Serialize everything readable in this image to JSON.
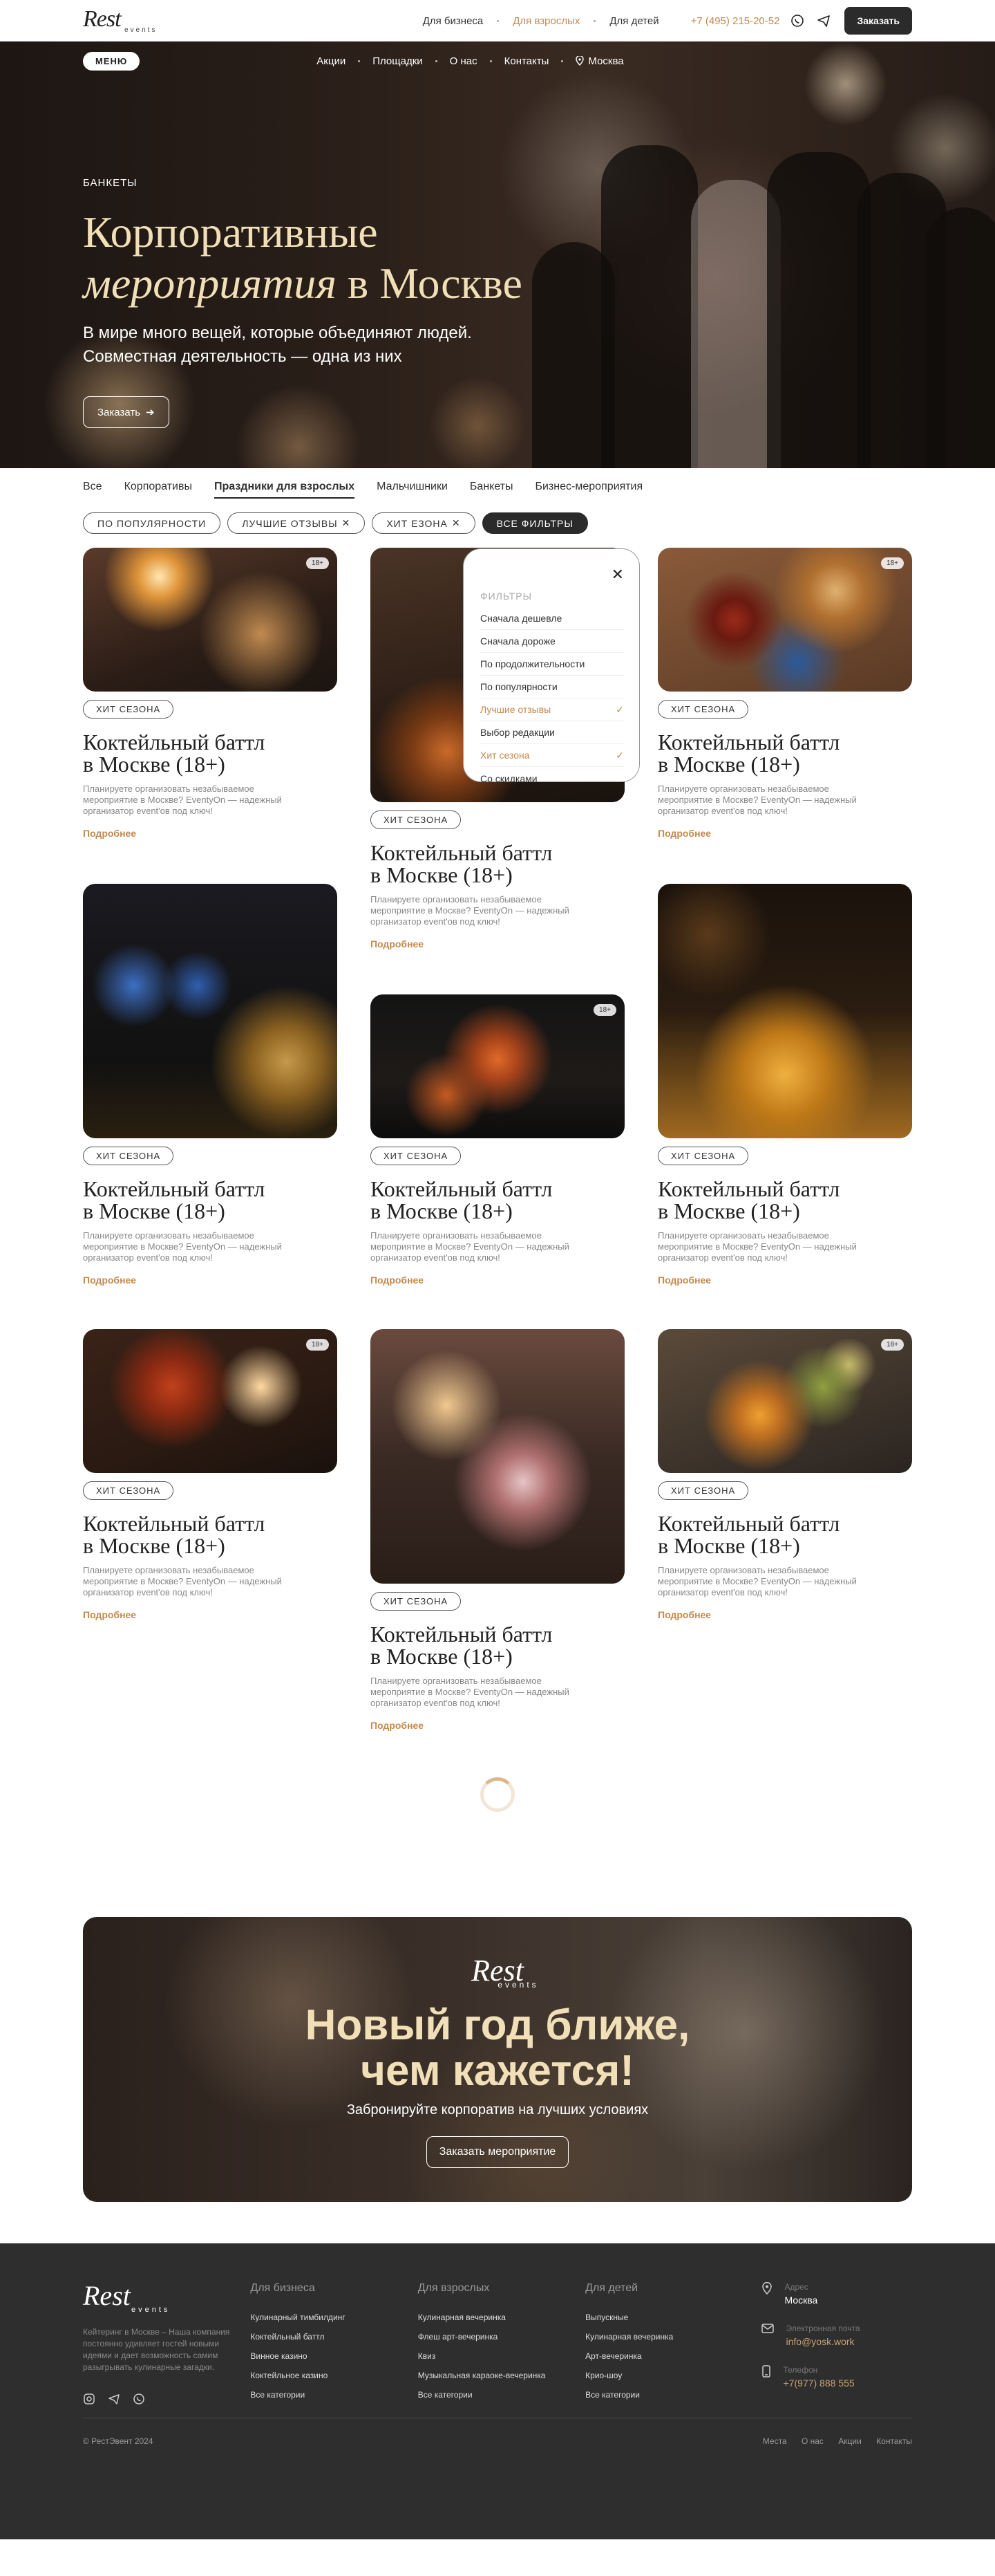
{
  "header": {
    "logo_main": "Rest",
    "logo_sub": "events",
    "nav": [
      "Для бизнеса",
      "Для взрослых",
      "Для детей"
    ],
    "active_nav": "Для взрослых",
    "phone": "+7 (495) 215-20-52",
    "order_label": "Заказать"
  },
  "hero": {
    "menu_label": "МЕНЮ",
    "links": [
      "Акции",
      "Площадки",
      "О нас",
      "Контакты"
    ],
    "city": "Москва",
    "eyebrow": "БАНКЕТЫ",
    "title_line1": "Корпоративные",
    "title_em": "мероприятия",
    "title_rest": " в Москве",
    "lead_line1": "В мире много вещей, которые объединяют людей.",
    "lead_line2": "Совместная деятельность — одна из них",
    "order_label": "Заказать"
  },
  "tabs": {
    "items": [
      "Все",
      "Корпоративы",
      "Праздники для взрослых",
      "Мальчишники",
      "Банкеты",
      "Бизнес-мероприятия"
    ],
    "active": "Праздники для взрослых"
  },
  "chips": {
    "sort": "ПО ПОПУЛЯРНОСТИ",
    "f1": "ЛУЧШИЕ ОТЗЫВЫ",
    "f2": "ХИТ ЕЗОНА",
    "all": "ВСЕ ФИЛЬТРЫ"
  },
  "filters": {
    "title": "ФИЛЬТРЫ",
    "options": [
      {
        "label": "Сначала дешевле",
        "selected": false
      },
      {
        "label": "Сначала дороже",
        "selected": false
      },
      {
        "label": "По продолжительности",
        "selected": false
      },
      {
        "label": "По популярности",
        "selected": false
      },
      {
        "label": "Лучшие отзывы",
        "selected": true
      },
      {
        "label": "Выбор редакции",
        "selected": false
      },
      {
        "label": "Хит сезона",
        "selected": true
      },
      {
        "label": "Со скидками",
        "selected": false
      }
    ]
  },
  "card": {
    "badge": "ХИТ СЕЗОНА",
    "title_line1": "Коктейльный баттл",
    "title_line2": "в Москве (18+)",
    "desc": "Планируете организовать незабываемое мероприятие в Москве? EventyOn — надежный организатор event'ов под ключ!",
    "more": "Подробнее",
    "age": "18+"
  },
  "banner": {
    "logo_main": "Rest",
    "logo_sub": "events",
    "title_line1": "Новый год ближе,",
    "title_line2": "чем кажется!",
    "subtitle": "Забронируйте корпоратив на лучших условиях",
    "button": "Заказать мероприятие"
  },
  "footer": {
    "logo_main": "Rest",
    "logo_sub": "events",
    "about": "Кейтеринг в Москве – Наша компания постоянно удивляет гостей новыми идеями и дает возможность самим разыгрывать кулинарные загадки.",
    "col1_title": "Для бизнеса",
    "col1": [
      "Кулинарный тимбилдинг",
      "Коктейльный баттл",
      "Винное казино",
      "Коктейльное казино",
      "Все категории"
    ],
    "col2_title": "Для взрослых",
    "col2": [
      "Кулинарная вечеринка",
      "Флеш арт-вечеринка",
      "Квиз",
      "Музыкальная караоке-вечеринка",
      "Все категории"
    ],
    "col3_title": "Для детей",
    "col3": [
      "Выпускные",
      "Кулинарная вечеринка",
      "Арт-вечеринка",
      "Крио-шоу",
      "Все категории"
    ],
    "address_label": "Адрес",
    "address": "Москва",
    "email_label": "Электронная почта",
    "email": "info@yosk.work",
    "phone_label": "Телефон",
    "phone": "+7(977) 888 555",
    "copyright": "© РестЭвент 2024",
    "bottom_links": [
      "Места",
      "О нас",
      "Акции",
      "Контакты"
    ]
  },
  "colors": {
    "accent": "#c28a4e",
    "dark": "#2b2b2b",
    "hero_title": "#f1dfb8"
  }
}
